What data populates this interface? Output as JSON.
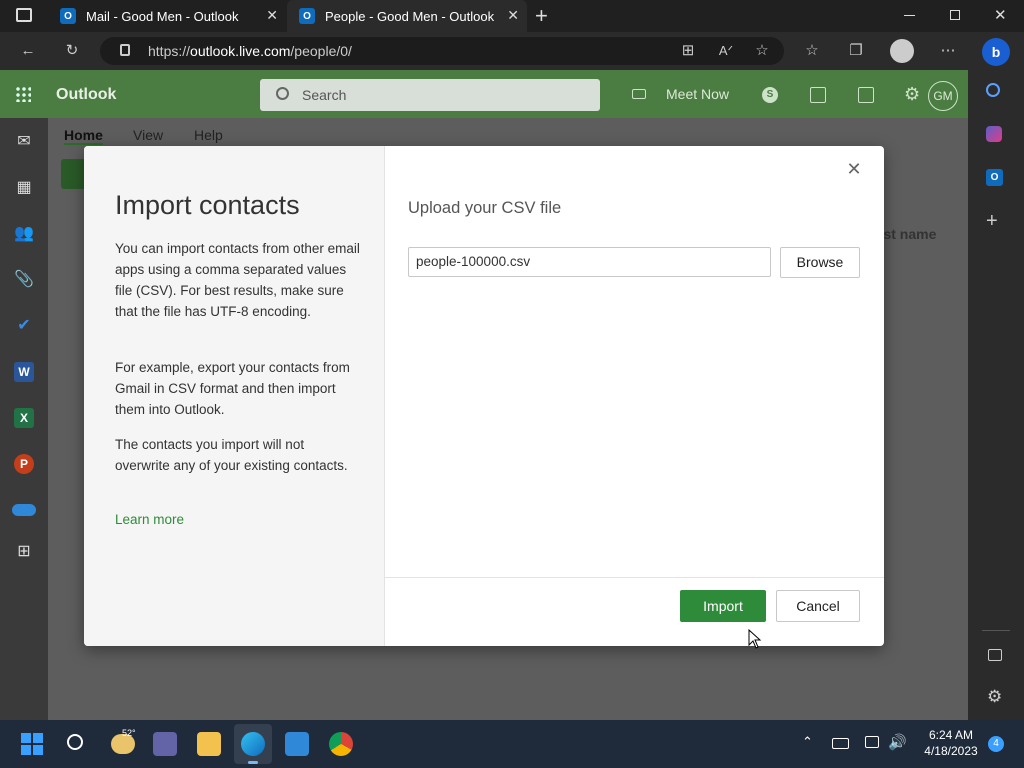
{
  "browser": {
    "tabs": [
      {
        "label": "Mail - Good Men - Outlook",
        "active": false
      },
      {
        "label": "People - Good Men - Outlook",
        "active": true
      }
    ],
    "new_tab_label": "+",
    "url_prefix": "https://",
    "url_host": "outlook.live.com",
    "url_path": "/people/0/"
  },
  "outlook": {
    "app_name": "Outlook",
    "search_placeholder": "Search",
    "meet_now": "Meet Now",
    "avatar_initials": "GM",
    "ribbon_tabs": [
      "Home",
      "View",
      "Help"
    ],
    "column_header_partial": "rst name"
  },
  "dialog": {
    "title": "Import contacts",
    "paragraphs": [
      "You can import contacts from other email apps using a comma separated values file (CSV). For best results, make sure that the file has UTF-8 encoding.",
      "For example, export your contacts from Gmail in CSV format and then import them into Outlook.",
      "The contacts you import will not overwrite any of your existing contacts."
    ],
    "learn_more": "Learn more",
    "upload_title": "Upload your CSV file",
    "file_value": "people-100000.csv",
    "browse_label": "Browse",
    "import_label": "Import",
    "cancel_label": "Cancel"
  },
  "taskbar": {
    "weather_temp": "52°",
    "time": "6:24 AM",
    "date": "4/18/2023",
    "notification_count": "4"
  },
  "colors": {
    "accent_green": "#2e8b3a",
    "outlook_header": "#4b7d42",
    "edge_blue": "#0f6cbd"
  }
}
